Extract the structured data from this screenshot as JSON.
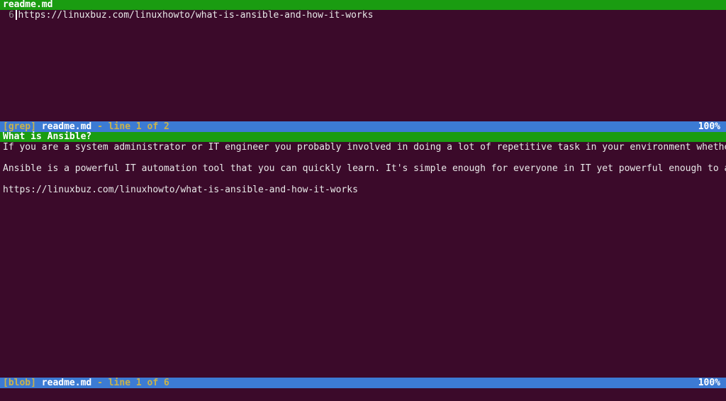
{
  "title": "readme.md",
  "top": {
    "line_number": "6",
    "text": "https://linuxbuz.com/linuxhowto/what-is-ansible-and-how-it-works"
  },
  "status_mid": {
    "mode": "[grep]",
    "file": "readme.md",
    "dash": " - ",
    "pos": "line 1 of 2",
    "pct": "100%"
  },
  "heading": "What is Ansible?",
  "body": {
    "l1": "If you are a system administrator or IT engineer you probably involved in doing a lot of repetitive task in your environment whether it be sizi",
    "l2": "",
    "l3": "Ansible is a powerful IT automation tool that you can quickly learn. It's simple enough for everyone in IT yet powerful enough to automate even",
    "l4": "",
    "l5": "https://linuxbuz.com/linuxhowto/what-is-ansible-and-how-it-works"
  },
  "status_bot": {
    "mode": "[blob]",
    "file": "readme.md",
    "dash": " - ",
    "pos": "line 1 of 6",
    "pct": "100%"
  }
}
